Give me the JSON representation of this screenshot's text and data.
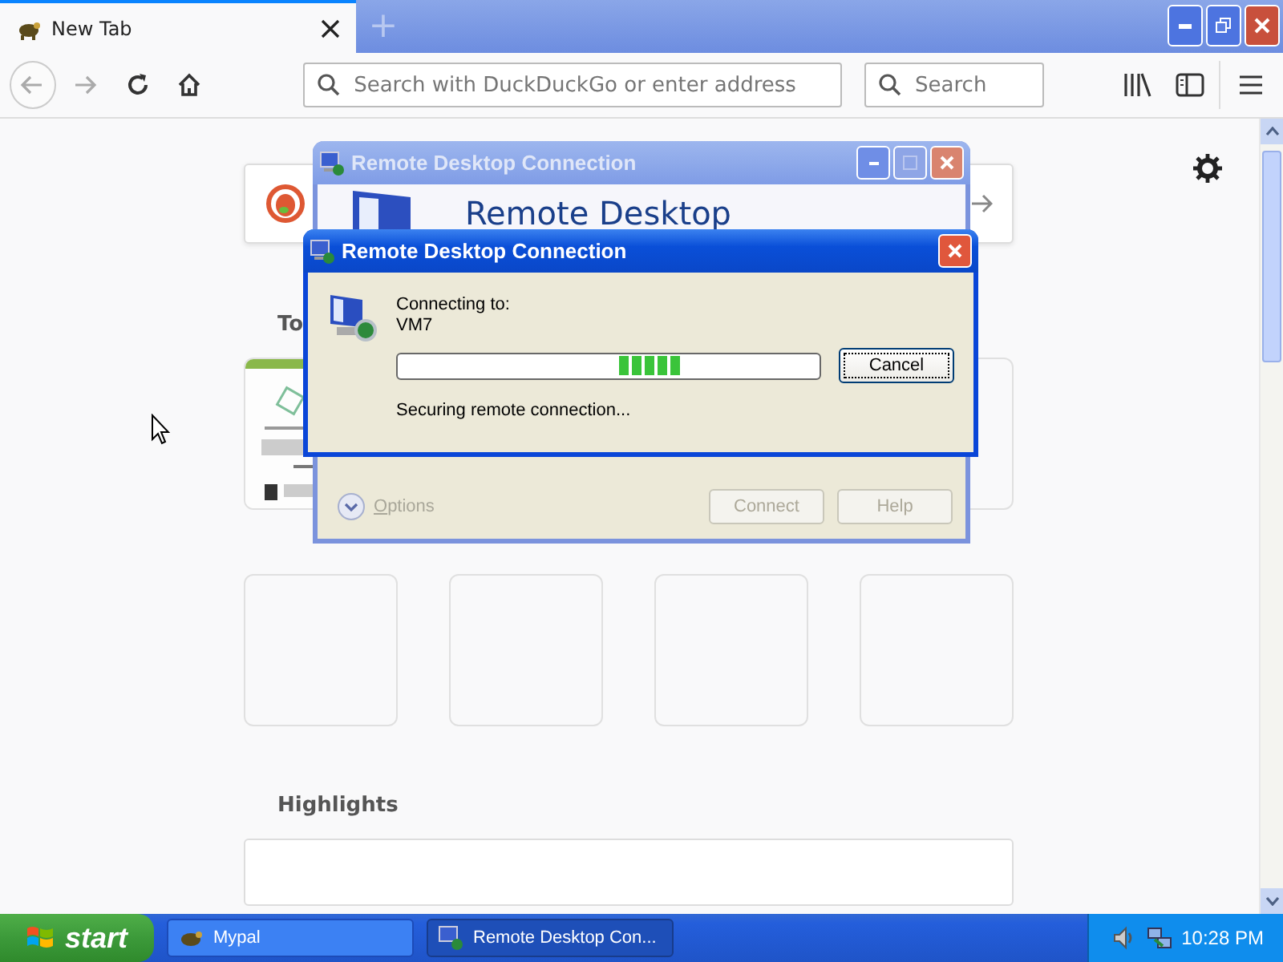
{
  "browser": {
    "tabs": [
      {
        "title": "New Tab",
        "selected": true
      }
    ],
    "new_tab_button": "+",
    "address_bar": {
      "placeholder": "Search with DuckDuckGo or enter address"
    },
    "search_bar": {
      "placeholder": "Search"
    }
  },
  "new_tab_page": {
    "top_sites_heading": "To",
    "tiles": [
      {
        "kind": "thumbnail"
      },
      {
        "kind": "empty"
      },
      {
        "kind": "empty"
      },
      {
        "kind": "empty"
      },
      {
        "kind": "empty"
      },
      {
        "kind": "empty"
      }
    ],
    "highlights_heading": "Highlights"
  },
  "back_dialog": {
    "title": "Remote Desktop Connection",
    "banner": "Remote Desktop",
    "options": "Options",
    "buttons": [
      {
        "label": "Connect",
        "disabled": true
      },
      {
        "label": "Help",
        "disabled": true
      }
    ]
  },
  "front_dialog": {
    "title": "Remote Desktop Connection",
    "connecting_label": "Connecting to:",
    "host": "VM7",
    "status": "Securing remote connection...",
    "buttons": [
      {
        "label": "Cancel",
        "disabled": false
      }
    ]
  },
  "taskbar": {
    "start": "start",
    "items": [
      {
        "label": "Mypal",
        "selected": false
      },
      {
        "label": "Remote Desktop Con...",
        "selected": true
      }
    ],
    "clock": "10:28 PM"
  }
}
